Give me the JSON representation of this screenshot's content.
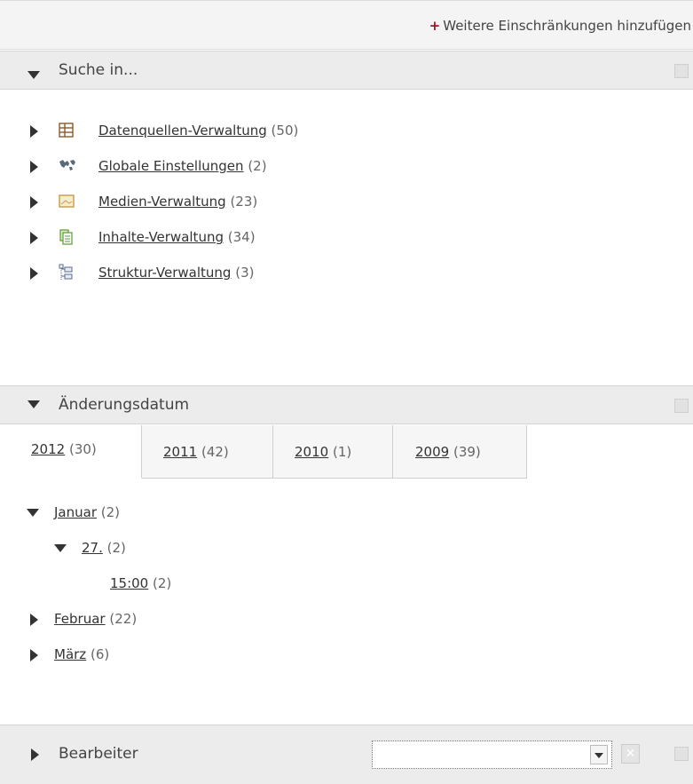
{
  "toolbar": {
    "add_prefix": "+",
    "add_label": "Weitere Einschränkungen hinzufügen"
  },
  "search_in": {
    "title": "Suche in...",
    "items": [
      {
        "label": "Datenquellen-Verwaltung",
        "count": "(50)",
        "icon": "table-icon"
      },
      {
        "label": "Globale Einstellungen",
        "count": "(2)",
        "icon": "globe-map-icon"
      },
      {
        "label": "Medien-Verwaltung",
        "count": "(23)",
        "icon": "media-icon"
      },
      {
        "label": "Inhalte-Verwaltung",
        "count": "(34)",
        "icon": "pages-icon"
      },
      {
        "label": "Struktur-Verwaltung",
        "count": "(3)",
        "icon": "structure-icon"
      }
    ]
  },
  "change_date": {
    "title": "Änderungsdatum",
    "tabs": [
      {
        "label": "2012",
        "count": "(30)",
        "active": true
      },
      {
        "label": "2011",
        "count": "(42)",
        "active": false
      },
      {
        "label": "2010",
        "count": "(1)",
        "active": false
      },
      {
        "label": "2009",
        "count": "(39)",
        "active": false
      }
    ],
    "tree": [
      {
        "label": "Januar",
        "count": "(2)",
        "expanded": true
      },
      {
        "label": "27.",
        "count": "(2)",
        "expanded": true
      },
      {
        "label": "15:00",
        "count": "(2)"
      },
      {
        "label": "Februar",
        "count": "(22)",
        "expanded": false
      },
      {
        "label": "März",
        "count": "(6)",
        "expanded": false
      }
    ]
  },
  "editor": {
    "title": "Bearbeiter",
    "combo_value": ""
  },
  "colors": {
    "accent_plus": "#a0122a",
    "header_bg": "#ececec"
  }
}
